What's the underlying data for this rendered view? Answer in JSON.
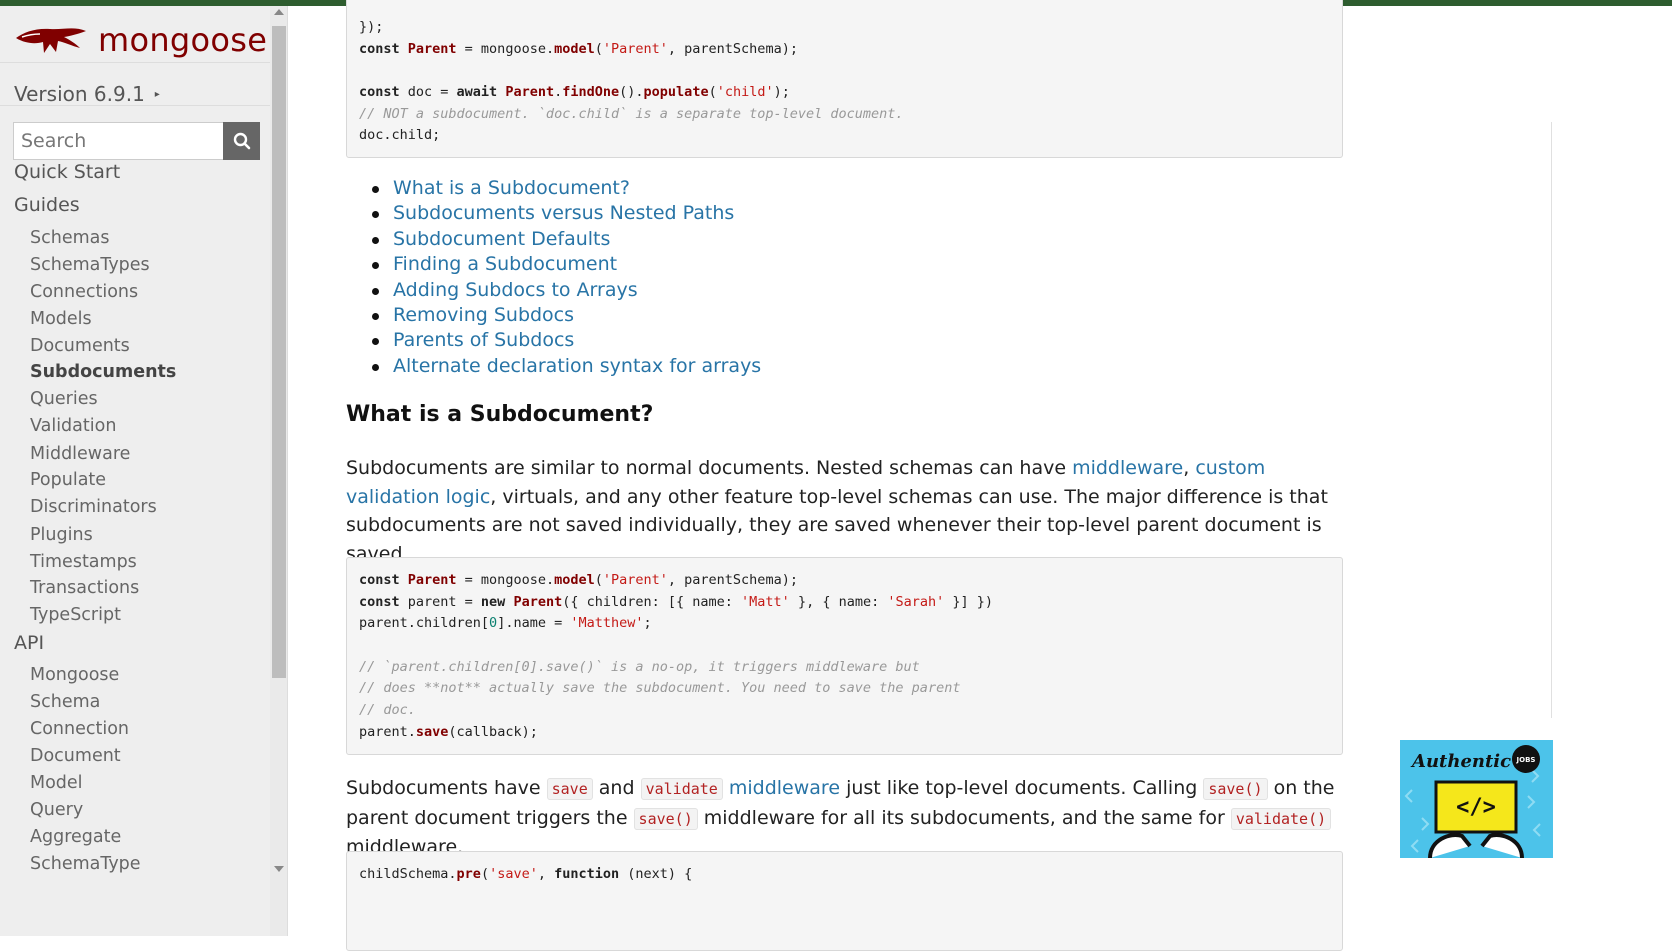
{
  "sidebar": {
    "brand": "mongoose",
    "version": "Version 6.9.1",
    "version_caret": "▸",
    "search_placeholder": "Search",
    "sections": {
      "quick_start": "Quick Start",
      "guides": "Guides",
      "api": "API"
    },
    "guides": [
      "Schemas",
      "SchemaTypes",
      "Connections",
      "Models",
      "Documents",
      "Subdocuments",
      "Queries",
      "Validation",
      "Middleware",
      "Populate",
      "Discriminators",
      "Plugins",
      "Timestamps",
      "Transactions",
      "TypeScript"
    ],
    "active_guide": "Subdocuments",
    "api": [
      "Mongoose",
      "Schema",
      "Connection",
      "Document",
      "Model",
      "Query",
      "Aggregate",
      "SchemaType"
    ]
  },
  "code1": {
    "l0": "});",
    "l1a": "const",
    "l1b": " Parent",
    "l1c": " = mongoose.",
    "l1d": "model",
    "l1e": "(",
    "l1f": "'Parent'",
    "l1g": ", parentSchema);",
    "l3a": "const",
    "l3b": " doc = ",
    "l3c": "await",
    "l3d": " ",
    "l3e": "Parent",
    "l3f": ".",
    "l3g": "findOne",
    "l3h": "().",
    "l3i": "populate",
    "l3j": "(",
    "l3k": "'child'",
    "l3l": ");",
    "l4": "// NOT a subdocument. `doc.child` is a separate top-level document.",
    "l5": "doc.child;"
  },
  "toc": [
    "What is a Subdocument?",
    "Subdocuments versus Nested Paths",
    "Subdocument Defaults",
    "Finding a Subdocument",
    "Adding Subdocs to Arrays",
    "Removing Subdocs",
    "Parents of Subdocs",
    "Alternate declaration syntax for arrays"
  ],
  "section1": {
    "heading": "What is a Subdocument?",
    "p_a": "Subdocuments are similar to normal documents. Nested schemas can have ",
    "p_link1": "middleware",
    "p_b": ", ",
    "p_link2": "custom validation logic",
    "p_c": ", virtuals, and any other feature top-level schemas can use. The major difference is that subdocuments are not saved individually, they are saved whenever their top-level parent document is saved."
  },
  "code2": {
    "l1a": "const",
    "l1b": " Parent",
    "l1c": " = mongoose.",
    "l1d": "model",
    "l1e": "(",
    "l1f": "'Parent'",
    "l1g": ", parentSchema);",
    "l2a": "const",
    "l2b": " parent = ",
    "l2c": "new",
    "l2d": " ",
    "l2e": "Parent",
    "l2f": "({ children: [{ name: ",
    "l2g": "'Matt'",
    "l2h": " }, { name: ",
    "l2i": "'Sarah'",
    "l2j": " }] })",
    "l3a": "parent.children[",
    "l3b": "0",
    "l3c": "].name = ",
    "l3d": "'Matthew'",
    "l3e": ";",
    "l5": "// `parent.children[0].save()` is a no-op, it triggers middleware but",
    "l6": "// does **not** actually save the subdocument. You need to save the parent",
    "l7": "// doc.",
    "l8a": "parent.",
    "l8b": "save",
    "l8c": "(callback);"
  },
  "para2": {
    "a": "Subdocuments have ",
    "code_save": "save",
    "b": " and ",
    "code_validate": "validate",
    "c": " ",
    "link": "middleware",
    "d": " just like top-level documents. Calling ",
    "code_save2": "save()",
    "e": " on the parent document triggers the ",
    "code_save3": "save()",
    "f": " middleware for all its subdocuments, and the same for ",
    "code_validate2": "validate()",
    "g": " middleware."
  },
  "code3": {
    "l1a": "childSchema.",
    "l1b": "pre",
    "l1c": "(",
    "l1d": "'save'",
    "l1e": ", ",
    "l1f": "function",
    "l1g": " (next) {"
  },
  "ad": {
    "brand": "Authentic",
    "badge": "JOBS",
    "symbol": "</>"
  },
  "colors": {
    "brand": "#800000",
    "link": "#2874a6",
    "topbar": "#2e5d2f"
  }
}
